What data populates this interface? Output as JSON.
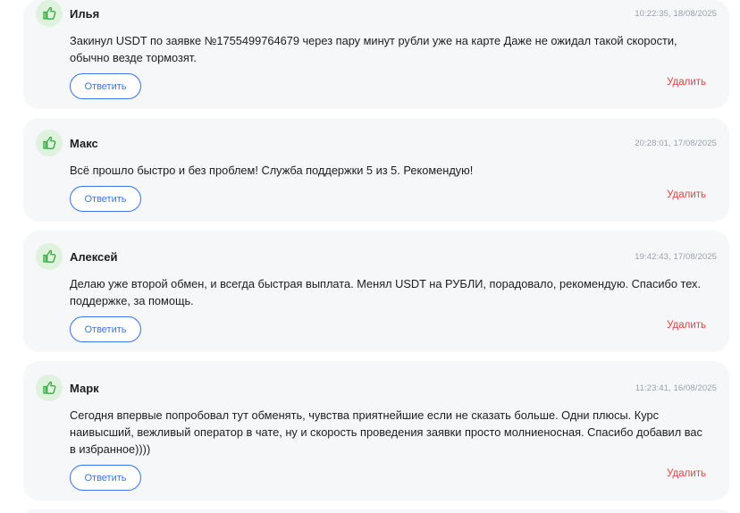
{
  "reviews": [
    {
      "author": "Илья",
      "timestamp": "10:22:35, 18/08/2025",
      "text": "Закинул USDT по заявке №1755499764679 через пару минут рубли уже на карте Даже не ожидал такой скорости, обычно везде тормозят.",
      "reply_label": "Ответить",
      "delete_label": "Удалить"
    },
    {
      "author": "Макс",
      "timestamp": "20:28:01, 17/08/2025",
      "text": "Всё прошло быстро и без проблем! Служба поддержки 5 из 5. Рекомендую!",
      "reply_label": "Ответить",
      "delete_label": "Удалить"
    },
    {
      "author": "Алексей",
      "timestamp": "19:42:43, 17/08/2025",
      "text": "Делаю уже второй обмен, и всегда быстрая выплата. Менял USDT на РУБЛИ, порадовало, рекомендую. Спасибо тех. поддержке, за помощь.",
      "reply_label": "Ответить",
      "delete_label": "Удалить"
    },
    {
      "author": "Марк",
      "timestamp": "11:23:41, 16/08/2025",
      "text": "Сегодня впервые попробовал тут обменять, чувства приятнейшие если не сказать больше. Одни плюсы. Курс наивысший, вежливый оператор в чате, ну и скорость проведения заявки просто молниеносная. Спасибо добавил вас в избранное))))",
      "reply_label": "Ответить",
      "delete_label": "Удалить"
    }
  ],
  "icons": {
    "like": "thumbs-up-icon"
  },
  "colors": {
    "accent": "#3b73f0",
    "danger": "#e2463f",
    "like_bg": "#dff2de",
    "like_icon": "#3aa845",
    "card_bg": "#f6f7f9",
    "timestamp": "#9ba1ab"
  }
}
